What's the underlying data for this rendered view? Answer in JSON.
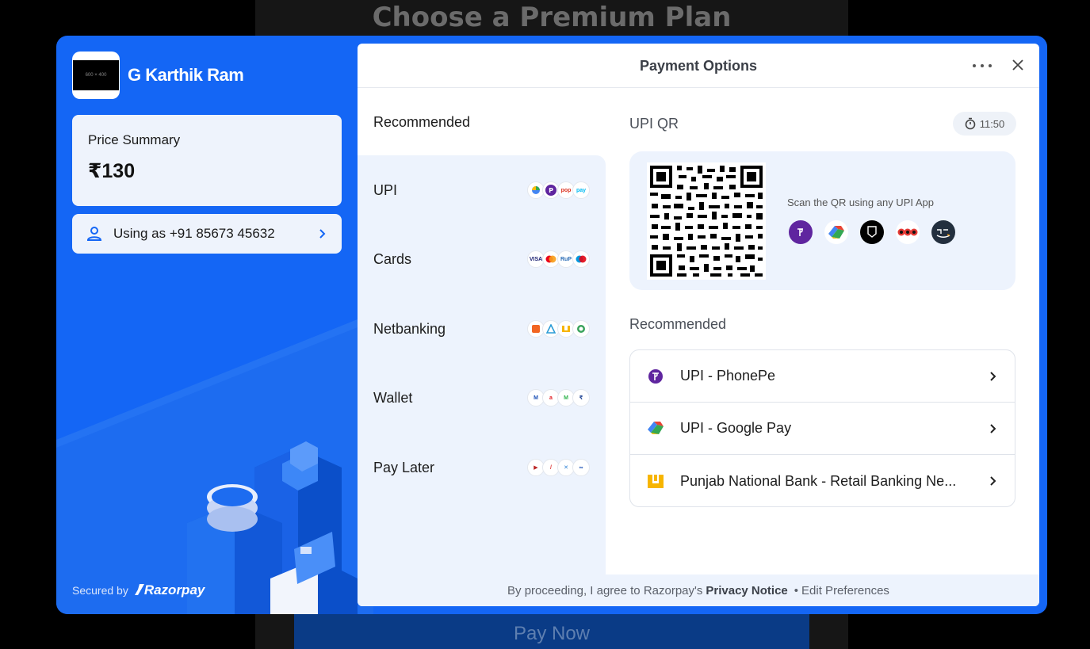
{
  "background": {
    "title": "Choose a Premium Plan",
    "pay_now": "Pay Now"
  },
  "merchant": {
    "logo_placeholder": "600 × 400",
    "name": "G Karthik Ram"
  },
  "price_summary": {
    "label": "Price Summary",
    "amount": "₹130"
  },
  "user": {
    "text": "Using as +91 85673 45632"
  },
  "secured": {
    "label": "Secured by",
    "brand": "Razorpay"
  },
  "panel": {
    "title": "Payment Options"
  },
  "methods": {
    "title": "Recommended",
    "items": [
      {
        "label": "UPI"
      },
      {
        "label": "Cards"
      },
      {
        "label": "Netbanking"
      },
      {
        "label": "Wallet"
      },
      {
        "label": "Pay Later"
      }
    ]
  },
  "upi_qr": {
    "title": "UPI QR",
    "timer": "11:50",
    "scan_text": "Scan the QR using any UPI App"
  },
  "recommended": {
    "title": "Recommended",
    "items": [
      {
        "label": "UPI - PhonePe",
        "icon": "phonepe-icon"
      },
      {
        "label": "UPI - Google Pay",
        "icon": "google-pay-icon"
      },
      {
        "label": "Punjab National Bank - Retail Banking Ne...",
        "icon": "pnb-icon"
      }
    ]
  },
  "footer": {
    "prefix": "By proceeding, I agree to Razorpay's",
    "privacy": "Privacy Notice",
    "separator": "•",
    "edit": "Edit Preferences"
  },
  "colors": {
    "brand_blue": "#1466f5",
    "panel_light": "#edf3fd",
    "phonepe": "#5f259f"
  }
}
